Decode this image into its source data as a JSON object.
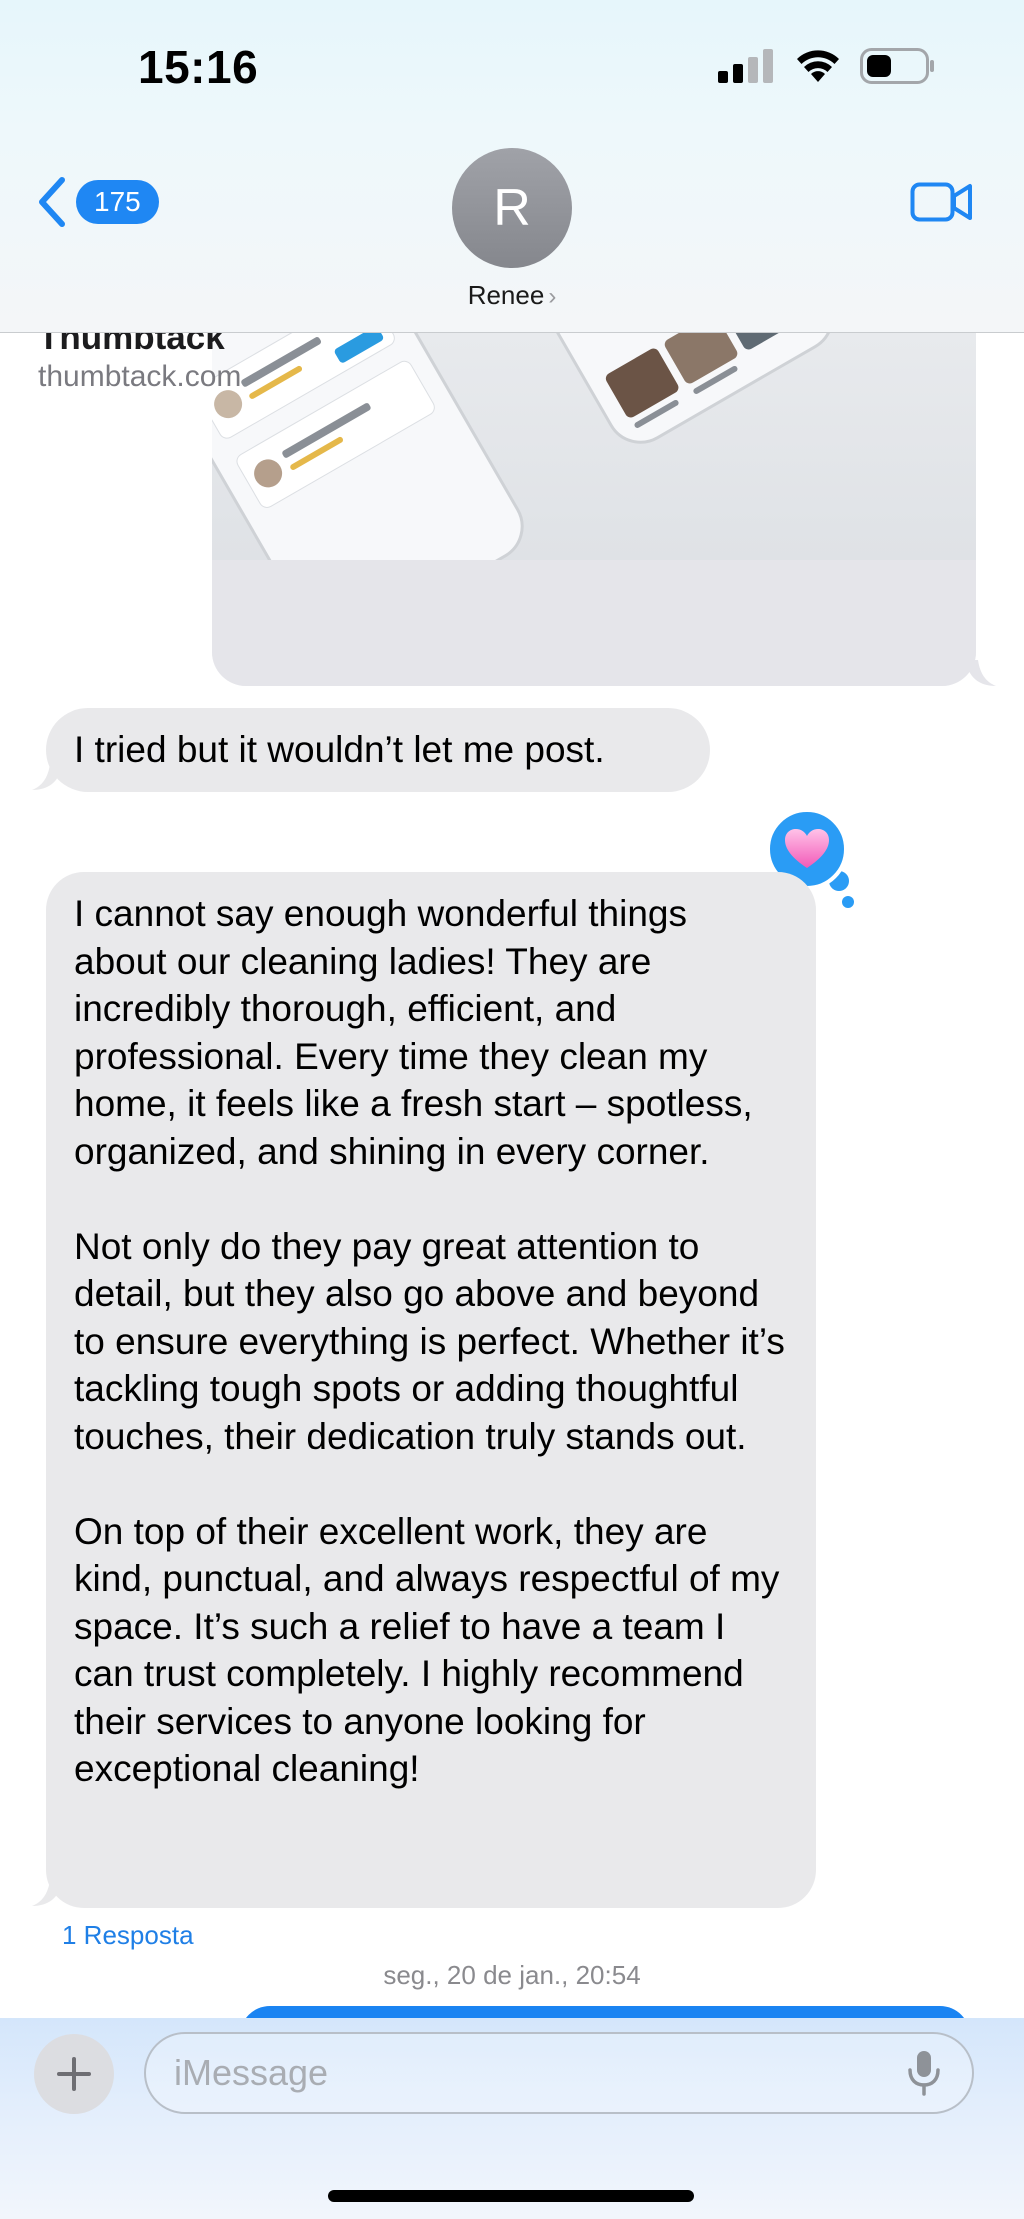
{
  "status_bar": {
    "time": "15:16"
  },
  "header": {
    "back_count": "175",
    "avatar_initial": "R",
    "contact_name": "Renee"
  },
  "link_preview": {
    "title": "Thumbtack",
    "domain": "thumbtack.com"
  },
  "messages": [
    {
      "text": "I tried but it wouldn’t let me post."
    },
    {
      "paragraphs": [
        "I cannot say enough wonderful things about our cleaning ladies! They are incredibly thorough, efficient, and professional. Every time they clean my home, it feels like a fresh start – spotless, organized, and shining in every corner.",
        "Not only do they pay great attention to detail, but they also go above and beyond to ensure everything is perfect. Whether it’s tackling tough spots or adding thoughtful touches, their dedication truly stands out.",
        "On top of their excellent work, they are kind, punctual, and always respectful of my space. It’s such a relief to have a team I can trust completely. I highly recommend their services to anyone looking for exceptional cleaning!"
      ],
      "reaction": "heart-icon",
      "reply_count": "1 Resposta"
    }
  ],
  "timestamp": "seg., 20 de jan., 20:54",
  "composer": {
    "placeholder": "iMessage"
  },
  "colors": {
    "accent": "#1f87f3",
    "received_bubble": "#e9e9eb",
    "reaction": "#2a9cf5"
  }
}
